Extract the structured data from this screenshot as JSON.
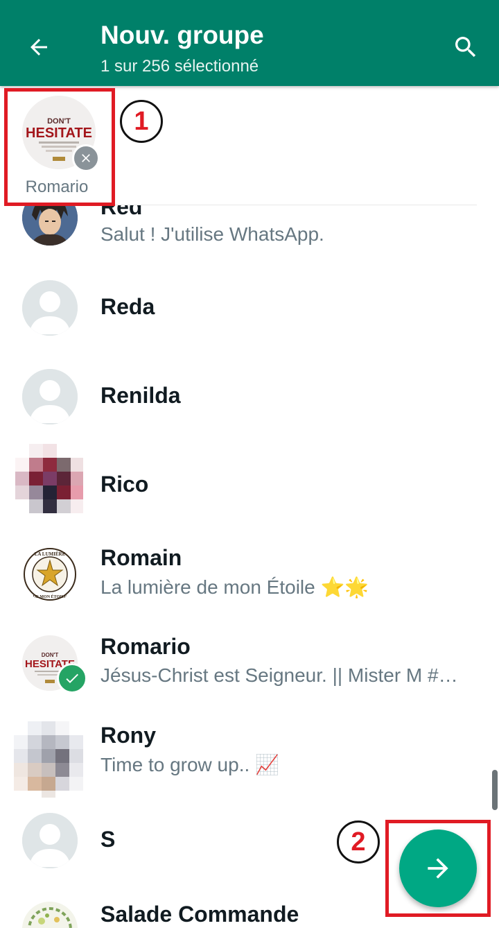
{
  "header": {
    "title": "Nouv. groupe",
    "subtitle": "1 sur 256 sélectionné",
    "background": "#008069"
  },
  "selected": [
    {
      "name": "Romario",
      "avatar_text_top": "DON'T",
      "avatar_text_main": "HESITATE"
    }
  ],
  "annotations": {
    "marker1": "1",
    "marker2": "2",
    "color": "#e01b24"
  },
  "contacts": [
    {
      "name": "Red",
      "status": "Salut ! J'utilise WhatsApp.",
      "avatar": "anime-portrait"
    },
    {
      "name": "Reda",
      "status": "",
      "avatar": "default-person-icon"
    },
    {
      "name": "Renilda",
      "status": "",
      "avatar": "default-person-icon"
    },
    {
      "name": "Rico",
      "status": "",
      "avatar": "pixelated-photo"
    },
    {
      "name": "Romain",
      "status": "La lumière de mon Étoile ⭐🌟",
      "avatar": "star-logo"
    },
    {
      "name": "Romario",
      "status": "Jésus-Christ est Seigneur. || Mister M #…",
      "avatar": "dont-hesitate-logo",
      "selected": true
    },
    {
      "name": "Rony",
      "status": "Time to grow up.. 📈",
      "avatar": "pixelated-photo"
    },
    {
      "name": "S",
      "status": "",
      "avatar": "default-person-icon"
    },
    {
      "name": "Salade Commande",
      "status": "",
      "avatar": "food-photo"
    }
  ],
  "fab": {
    "icon": "arrow-right-icon",
    "color": "#00a884"
  },
  "logo_text": {
    "star_top": "LA LUMIÈRE",
    "star_bottom": "DE MON ÉTOILE"
  }
}
